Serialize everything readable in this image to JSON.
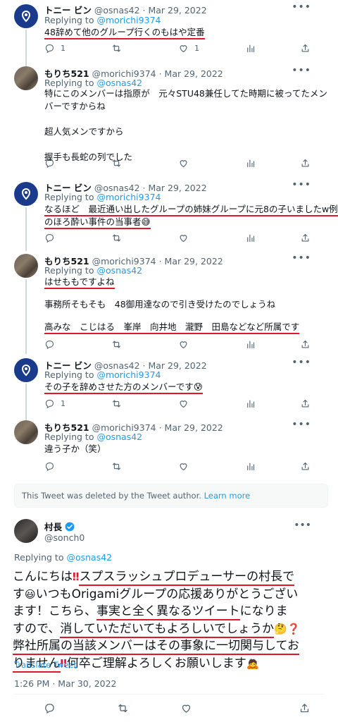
{
  "tweets": [
    {
      "name": "トニー ビン",
      "meta": "@osnas42 · Mar 29, 2022",
      "replying_prefix": "Replying to ",
      "replying_to": "@morichi9374",
      "lines": [
        "48辞めて他のグループ行くのもはや定番"
      ],
      "counts": {
        "reply": "1",
        "retweet": "",
        "like": "1"
      }
    },
    {
      "name": "もりち521",
      "meta": "@morichi9374 · Mar 29, 2022",
      "replying_prefix": "Replying to ",
      "replying_to": "@osnas42",
      "lines": [
        "特にこのメンバーは指原が　元々STU48兼任してた時期に被ってたメン",
        "バーですからね",
        "",
        "超人気メンですから",
        "",
        "握手も長蛇の列でした"
      ],
      "counts": {
        "reply": "",
        "retweet": "",
        "like": ""
      }
    },
    {
      "name": "トニー ビン",
      "meta": "@osnas42 · Mar 29, 2022",
      "replying_prefix": "Replying to ",
      "replying_to": "@morichi9374",
      "lines": [
        "なるほど　最近通い出したグループの姉妹グループに元8の子いましたw例",
        "のほろ酔い事件の当事者😅"
      ],
      "counts": {
        "reply": "",
        "retweet": "",
        "like": ""
      }
    },
    {
      "name": "もりち521",
      "meta": "@morichi9374 · Mar 29, 2022",
      "replying_prefix": "Replying to ",
      "replying_to": "@osnas42",
      "lines": [
        "はせももですよね",
        "",
        "事務所そもそも　48御用達なので引き受けたのでしょうね",
        "",
        "高みな　こじはる　峯岸　向井地　瀧野　田島などなど所属です"
      ],
      "counts": {
        "reply": "",
        "retweet": "",
        "like": ""
      }
    },
    {
      "name": "トニー ビン",
      "meta": "@osnas42 · Mar 29, 2022",
      "replying_prefix": "Replying to ",
      "replying_to": "@morichi9374",
      "lines": [
        "その子を辞めさせた方のメンバーです😰"
      ],
      "counts": {
        "reply": "1",
        "retweet": "",
        "like": ""
      }
    },
    {
      "name": "もりち521",
      "meta": "@morichi9374 · Mar 29, 2022",
      "replying_prefix": "Replying to ",
      "replying_to": "@osnas42",
      "lines": [
        "違う子か（笑）"
      ],
      "counts": {
        "reply": "",
        "retweet": "",
        "like": ""
      }
    }
  ],
  "deleted_notice": {
    "text": "This Tweet was deleted by the Tweet author. ",
    "link": "Learn more"
  },
  "main_tweet": {
    "name": "村長",
    "handle": "@sonch0",
    "replying_prefix": "Replying to ",
    "replying_to": "@osnas42",
    "text_parts": [
      "こんにちは",
      "‼",
      "スプスラッシュプロデューサーの村長で",
      "す",
      "😃",
      "いつもOrigamiグループの応援ありがとうござい",
      "ます！こちら、",
      "事実と全く異なるツイート",
      "になりま",
      "すので、",
      "消していただいてもよろしいでしょうか",
      "🤔❓",
      "弊社所属の当該メンバーはその事象に一切関与してお",
      "りません",
      "‼",
      "何卒ご理解よろしくお願いします",
      "🙇"
    ],
    "translate": "Translate Tweet",
    "timestamp": "1:26 PM · Mar 30, 2022"
  },
  "icons": [
    "more-icon",
    "reply-icon",
    "retweet-icon",
    "like-icon",
    "stats-icon",
    "share-icon",
    "verified-icon"
  ],
  "colors": {
    "link": "#1d9bf0",
    "underline": "#e0162b",
    "muted": "#536471",
    "colts_blue": "#1a3b8c"
  }
}
